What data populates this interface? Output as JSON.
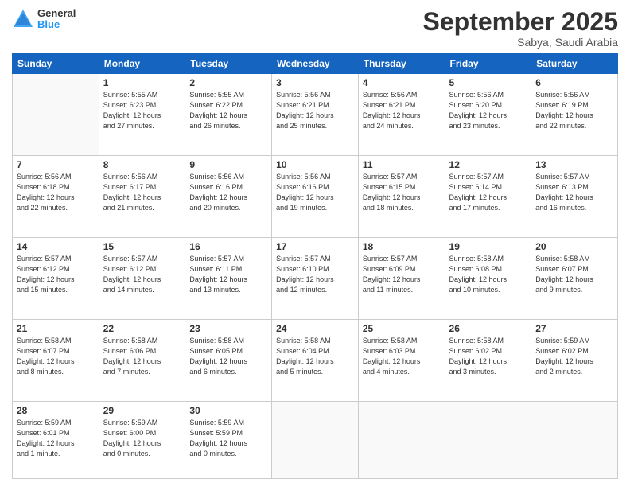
{
  "logo": {
    "general": "General",
    "blue": "Blue"
  },
  "header": {
    "month": "September 2025",
    "location": "Sabya, Saudi Arabia"
  },
  "weekdays": [
    "Sunday",
    "Monday",
    "Tuesday",
    "Wednesday",
    "Thursday",
    "Friday",
    "Saturday"
  ],
  "weeks": [
    [
      {
        "day": "",
        "info": ""
      },
      {
        "day": "1",
        "info": "Sunrise: 5:55 AM\nSunset: 6:23 PM\nDaylight: 12 hours\nand 27 minutes."
      },
      {
        "day": "2",
        "info": "Sunrise: 5:55 AM\nSunset: 6:22 PM\nDaylight: 12 hours\nand 26 minutes."
      },
      {
        "day": "3",
        "info": "Sunrise: 5:56 AM\nSunset: 6:21 PM\nDaylight: 12 hours\nand 25 minutes."
      },
      {
        "day": "4",
        "info": "Sunrise: 5:56 AM\nSunset: 6:21 PM\nDaylight: 12 hours\nand 24 minutes."
      },
      {
        "day": "5",
        "info": "Sunrise: 5:56 AM\nSunset: 6:20 PM\nDaylight: 12 hours\nand 23 minutes."
      },
      {
        "day": "6",
        "info": "Sunrise: 5:56 AM\nSunset: 6:19 PM\nDaylight: 12 hours\nand 22 minutes."
      }
    ],
    [
      {
        "day": "7",
        "info": "Sunrise: 5:56 AM\nSunset: 6:18 PM\nDaylight: 12 hours\nand 22 minutes."
      },
      {
        "day": "8",
        "info": "Sunrise: 5:56 AM\nSunset: 6:17 PM\nDaylight: 12 hours\nand 21 minutes."
      },
      {
        "day": "9",
        "info": "Sunrise: 5:56 AM\nSunset: 6:16 PM\nDaylight: 12 hours\nand 20 minutes."
      },
      {
        "day": "10",
        "info": "Sunrise: 5:56 AM\nSunset: 6:16 PM\nDaylight: 12 hours\nand 19 minutes."
      },
      {
        "day": "11",
        "info": "Sunrise: 5:57 AM\nSunset: 6:15 PM\nDaylight: 12 hours\nand 18 minutes."
      },
      {
        "day": "12",
        "info": "Sunrise: 5:57 AM\nSunset: 6:14 PM\nDaylight: 12 hours\nand 17 minutes."
      },
      {
        "day": "13",
        "info": "Sunrise: 5:57 AM\nSunset: 6:13 PM\nDaylight: 12 hours\nand 16 minutes."
      }
    ],
    [
      {
        "day": "14",
        "info": "Sunrise: 5:57 AM\nSunset: 6:12 PM\nDaylight: 12 hours\nand 15 minutes."
      },
      {
        "day": "15",
        "info": "Sunrise: 5:57 AM\nSunset: 6:12 PM\nDaylight: 12 hours\nand 14 minutes."
      },
      {
        "day": "16",
        "info": "Sunrise: 5:57 AM\nSunset: 6:11 PM\nDaylight: 12 hours\nand 13 minutes."
      },
      {
        "day": "17",
        "info": "Sunrise: 5:57 AM\nSunset: 6:10 PM\nDaylight: 12 hours\nand 12 minutes."
      },
      {
        "day": "18",
        "info": "Sunrise: 5:57 AM\nSunset: 6:09 PM\nDaylight: 12 hours\nand 11 minutes."
      },
      {
        "day": "19",
        "info": "Sunrise: 5:58 AM\nSunset: 6:08 PM\nDaylight: 12 hours\nand 10 minutes."
      },
      {
        "day": "20",
        "info": "Sunrise: 5:58 AM\nSunset: 6:07 PM\nDaylight: 12 hours\nand 9 minutes."
      }
    ],
    [
      {
        "day": "21",
        "info": "Sunrise: 5:58 AM\nSunset: 6:07 PM\nDaylight: 12 hours\nand 8 minutes."
      },
      {
        "day": "22",
        "info": "Sunrise: 5:58 AM\nSunset: 6:06 PM\nDaylight: 12 hours\nand 7 minutes."
      },
      {
        "day": "23",
        "info": "Sunrise: 5:58 AM\nSunset: 6:05 PM\nDaylight: 12 hours\nand 6 minutes."
      },
      {
        "day": "24",
        "info": "Sunrise: 5:58 AM\nSunset: 6:04 PM\nDaylight: 12 hours\nand 5 minutes."
      },
      {
        "day": "25",
        "info": "Sunrise: 5:58 AM\nSunset: 6:03 PM\nDaylight: 12 hours\nand 4 minutes."
      },
      {
        "day": "26",
        "info": "Sunrise: 5:58 AM\nSunset: 6:02 PM\nDaylight: 12 hours\nand 3 minutes."
      },
      {
        "day": "27",
        "info": "Sunrise: 5:59 AM\nSunset: 6:02 PM\nDaylight: 12 hours\nand 2 minutes."
      }
    ],
    [
      {
        "day": "28",
        "info": "Sunrise: 5:59 AM\nSunset: 6:01 PM\nDaylight: 12 hours\nand 1 minute."
      },
      {
        "day": "29",
        "info": "Sunrise: 5:59 AM\nSunset: 6:00 PM\nDaylight: 12 hours\nand 0 minutes."
      },
      {
        "day": "30",
        "info": "Sunrise: 5:59 AM\nSunset: 5:59 PM\nDaylight: 12 hours\nand 0 minutes."
      },
      {
        "day": "",
        "info": ""
      },
      {
        "day": "",
        "info": ""
      },
      {
        "day": "",
        "info": ""
      },
      {
        "day": "",
        "info": ""
      }
    ]
  ]
}
